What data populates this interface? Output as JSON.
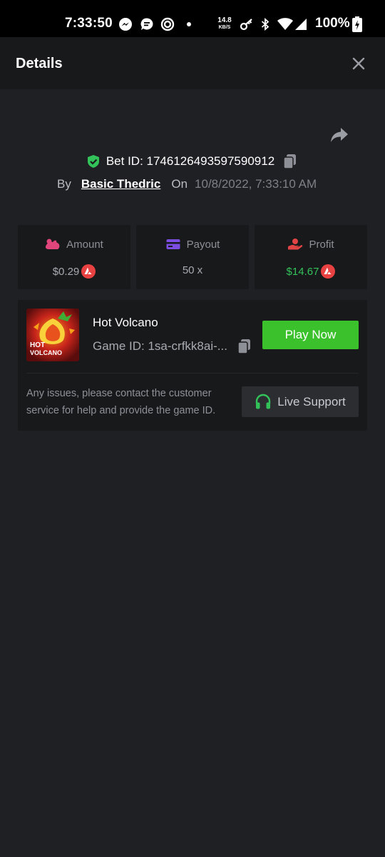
{
  "status_bar": {
    "time": "7:33:50",
    "net_speed": "14.8",
    "net_unit": "KB/S",
    "battery": "100%",
    "icons": [
      "messenger-icon",
      "chat-icon",
      "app-icon",
      "dot-icon",
      "key-icon",
      "bluetooth-icon",
      "wifi-icon",
      "signal-icon",
      "battery-charging-icon"
    ]
  },
  "header": {
    "title": "Details",
    "close_icon": "close-icon"
  },
  "bet": {
    "share_icon": "share-icon",
    "verified_icon": "shield-check-icon",
    "id_text": "Bet ID: 1746126493597590912",
    "copy_icon": "copy-icon",
    "by_label": "By",
    "user": "Basic Thedric",
    "on_label": "On",
    "date": "10/8/2022, 7:33:10 AM"
  },
  "stats": [
    {
      "label": "Amount",
      "value": "$0.29",
      "icon": "amount-icon",
      "coin_icon": "avax-coin-icon",
      "icon_color": "#e0457b"
    },
    {
      "label": "Payout",
      "value": "50 x",
      "icon": "card-icon",
      "icon_color": "#7b4de0"
    },
    {
      "label": "Profit",
      "value": "$14.67",
      "icon": "profit-icon",
      "coin_icon": "avax-coin-icon",
      "icon_color": "#e04444"
    }
  ],
  "game": {
    "thumb_text_1": "HOT",
    "thumb_text_2": "VOLCANO",
    "title": "Hot Volcano",
    "game_id": "Game ID: 1sa-crfkk8ai-...",
    "copy_icon": "copy-icon",
    "play_label": "Play Now",
    "support_text": "Any issues, please contact the customer service for help and provide the game ID.",
    "support_label": "Live Support",
    "support_icon": "headset-icon"
  },
  "colors": {
    "background": "#1f2023",
    "card": "#18191b",
    "accent_green": "#3ac12b",
    "profit_green": "#33c25a",
    "coin_red": "#e84142"
  }
}
